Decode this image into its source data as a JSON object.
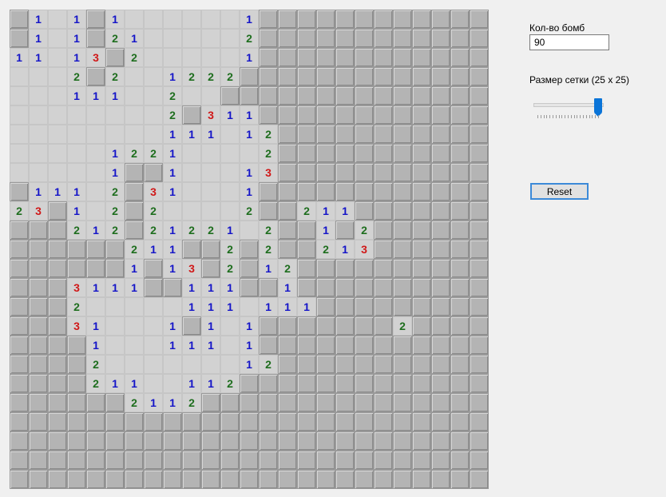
{
  "controls": {
    "bomb_count_label": "Кол-во бомб",
    "bomb_count_value": "90",
    "grid_size_label": "Размер сетки (25 x 25)",
    "grid_size_slider": {
      "value": 25,
      "min": 5,
      "max": 25
    },
    "reset_label": "Reset"
  },
  "board": {
    "rows": 25,
    "cols": 25,
    "legend": {
      "#": "closed",
      ".": "open empty",
      "1-8": "open with number"
    },
    "number_colors": {
      "1": "#1414c8",
      "2": "#1e6e1e",
      "3": "#d01818"
    },
    "cells": [
      "#1.1#1......1############",
      "#1.1#21.....2############",
      "11.13#2.....1############",
      "...2#2..1222#############",
      "...111..2..##############",
      "........2#311############",
      "........111.12###########",
      ".....1221....2###########",
      ".....1##1...13###########",
      "#111.2#31...1############",
      "23#1.2#2....2##211#######",
      "###212#21221.2##1#2######",
      "######211##2#2##213######",
      "######1#13#2#12##########",
      "###3111##111##1##########",
      "###2.....111.111#########",
      "###31...1#1.1#######2####",
      "####1...111.1############",
      "####2.......12###########",
      "####211..112#############",
      "######2112###############",
      "#########################",
      "#########################",
      "#########################",
      "#########################"
    ]
  }
}
